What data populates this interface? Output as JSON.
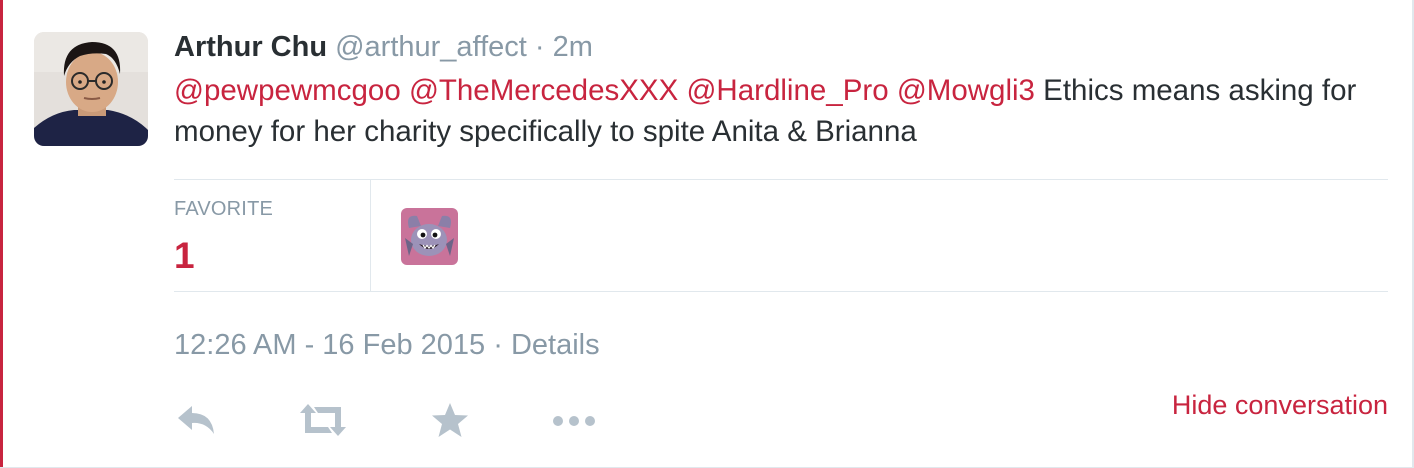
{
  "tweet": {
    "author": {
      "fullname": "Arthur Chu",
      "handle": "@arthur_affect"
    },
    "separator": "·",
    "relative_time": "2m",
    "mentions": [
      "@pewpewmcgoo",
      "@TheMercedesXXX",
      "@Hardline_Pro",
      "@Mowgli3"
    ],
    "text": " Ethics means asking for money for her charity specifically to spite Anita & Brianna",
    "stats": {
      "favorite_label": "FAVORITE",
      "favorite_count": "1"
    },
    "timestamp": "12:26 AM - 16 Feb 2015",
    "details_separator": "·",
    "details_link": "Details",
    "hide_conversation": "Hide conversation"
  },
  "icons": [
    "reply-icon",
    "retweet-icon",
    "favorite-star-icon",
    "more-icon"
  ],
  "colors": {
    "accent": "#c8243f",
    "text": "#292f33",
    "muted": "#8899a6",
    "border": "#e1e8ed"
  }
}
